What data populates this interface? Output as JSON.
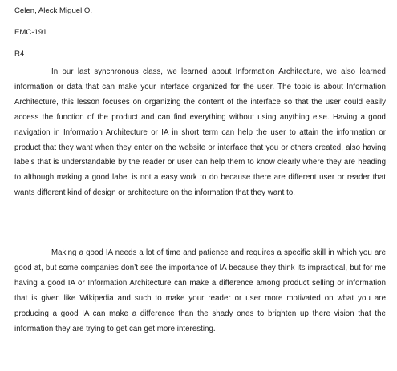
{
  "document": {
    "header": {
      "name": "Celen, Aleck Miguel O.",
      "course": "EMC-191",
      "code": "R4"
    },
    "paragraphs": [
      "In our last synchronous class, we learned about Information Architecture, we also learned information or data that can make your interface organized for the user. The topic is about Information Architecture, this lesson focuses on organizing the content of the interface so that the user could easily access the function of the product and can find everything without using anything else. Having a good navigation in Information Architecture or IA in short term can help the user to attain the information or product that they want when they enter on the website or interface that you or others created, also having labels that is understandable by the reader or user can help them to know clearly where they are heading to although making a good label is not a easy work to do because there are different user or reader that wants different kind of design or architecture on the information that they want to.",
      "Making a good IA needs a lot of time and patience and requires a specific skill in which you are good at, but some companies don’t see the importance of IA because they think its impractical, but for me having a good IA or Information Architecture can make a difference among product selling or information that is given like Wikipedia and such to make your reader or user more motivated on what you are producing a good IA can make a difference than the shady ones to brighten up there vision that the information they are trying to get can get more interesting."
    ]
  }
}
